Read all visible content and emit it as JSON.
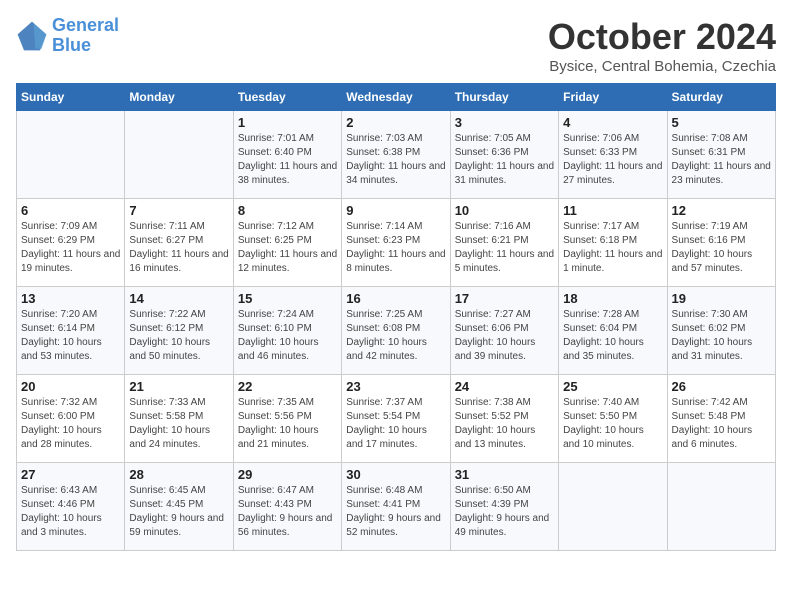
{
  "header": {
    "logo_line1": "General",
    "logo_line2": "Blue",
    "month": "October 2024",
    "location": "Bysice, Central Bohemia, Czechia"
  },
  "days_of_week": [
    "Sunday",
    "Monday",
    "Tuesday",
    "Wednesday",
    "Thursday",
    "Friday",
    "Saturday"
  ],
  "weeks": [
    [
      {
        "day": "",
        "info": ""
      },
      {
        "day": "",
        "info": ""
      },
      {
        "day": "1",
        "info": "Sunrise: 7:01 AM\nSunset: 6:40 PM\nDaylight: 11 hours and 38 minutes."
      },
      {
        "day": "2",
        "info": "Sunrise: 7:03 AM\nSunset: 6:38 PM\nDaylight: 11 hours and 34 minutes."
      },
      {
        "day": "3",
        "info": "Sunrise: 7:05 AM\nSunset: 6:36 PM\nDaylight: 11 hours and 31 minutes."
      },
      {
        "day": "4",
        "info": "Sunrise: 7:06 AM\nSunset: 6:33 PM\nDaylight: 11 hours and 27 minutes."
      },
      {
        "day": "5",
        "info": "Sunrise: 7:08 AM\nSunset: 6:31 PM\nDaylight: 11 hours and 23 minutes."
      }
    ],
    [
      {
        "day": "6",
        "info": "Sunrise: 7:09 AM\nSunset: 6:29 PM\nDaylight: 11 hours and 19 minutes."
      },
      {
        "day": "7",
        "info": "Sunrise: 7:11 AM\nSunset: 6:27 PM\nDaylight: 11 hours and 16 minutes."
      },
      {
        "day": "8",
        "info": "Sunrise: 7:12 AM\nSunset: 6:25 PM\nDaylight: 11 hours and 12 minutes."
      },
      {
        "day": "9",
        "info": "Sunrise: 7:14 AM\nSunset: 6:23 PM\nDaylight: 11 hours and 8 minutes."
      },
      {
        "day": "10",
        "info": "Sunrise: 7:16 AM\nSunset: 6:21 PM\nDaylight: 11 hours and 5 minutes."
      },
      {
        "day": "11",
        "info": "Sunrise: 7:17 AM\nSunset: 6:18 PM\nDaylight: 11 hours and 1 minute."
      },
      {
        "day": "12",
        "info": "Sunrise: 7:19 AM\nSunset: 6:16 PM\nDaylight: 10 hours and 57 minutes."
      }
    ],
    [
      {
        "day": "13",
        "info": "Sunrise: 7:20 AM\nSunset: 6:14 PM\nDaylight: 10 hours and 53 minutes."
      },
      {
        "day": "14",
        "info": "Sunrise: 7:22 AM\nSunset: 6:12 PM\nDaylight: 10 hours and 50 minutes."
      },
      {
        "day": "15",
        "info": "Sunrise: 7:24 AM\nSunset: 6:10 PM\nDaylight: 10 hours and 46 minutes."
      },
      {
        "day": "16",
        "info": "Sunrise: 7:25 AM\nSunset: 6:08 PM\nDaylight: 10 hours and 42 minutes."
      },
      {
        "day": "17",
        "info": "Sunrise: 7:27 AM\nSunset: 6:06 PM\nDaylight: 10 hours and 39 minutes."
      },
      {
        "day": "18",
        "info": "Sunrise: 7:28 AM\nSunset: 6:04 PM\nDaylight: 10 hours and 35 minutes."
      },
      {
        "day": "19",
        "info": "Sunrise: 7:30 AM\nSunset: 6:02 PM\nDaylight: 10 hours and 31 minutes."
      }
    ],
    [
      {
        "day": "20",
        "info": "Sunrise: 7:32 AM\nSunset: 6:00 PM\nDaylight: 10 hours and 28 minutes."
      },
      {
        "day": "21",
        "info": "Sunrise: 7:33 AM\nSunset: 5:58 PM\nDaylight: 10 hours and 24 minutes."
      },
      {
        "day": "22",
        "info": "Sunrise: 7:35 AM\nSunset: 5:56 PM\nDaylight: 10 hours and 21 minutes."
      },
      {
        "day": "23",
        "info": "Sunrise: 7:37 AM\nSunset: 5:54 PM\nDaylight: 10 hours and 17 minutes."
      },
      {
        "day": "24",
        "info": "Sunrise: 7:38 AM\nSunset: 5:52 PM\nDaylight: 10 hours and 13 minutes."
      },
      {
        "day": "25",
        "info": "Sunrise: 7:40 AM\nSunset: 5:50 PM\nDaylight: 10 hours and 10 minutes."
      },
      {
        "day": "26",
        "info": "Sunrise: 7:42 AM\nSunset: 5:48 PM\nDaylight: 10 hours and 6 minutes."
      }
    ],
    [
      {
        "day": "27",
        "info": "Sunrise: 6:43 AM\nSunset: 4:46 PM\nDaylight: 10 hours and 3 minutes."
      },
      {
        "day": "28",
        "info": "Sunrise: 6:45 AM\nSunset: 4:45 PM\nDaylight: 9 hours and 59 minutes."
      },
      {
        "day": "29",
        "info": "Sunrise: 6:47 AM\nSunset: 4:43 PM\nDaylight: 9 hours and 56 minutes."
      },
      {
        "day": "30",
        "info": "Sunrise: 6:48 AM\nSunset: 4:41 PM\nDaylight: 9 hours and 52 minutes."
      },
      {
        "day": "31",
        "info": "Sunrise: 6:50 AM\nSunset: 4:39 PM\nDaylight: 9 hours and 49 minutes."
      },
      {
        "day": "",
        "info": ""
      },
      {
        "day": "",
        "info": ""
      }
    ]
  ]
}
